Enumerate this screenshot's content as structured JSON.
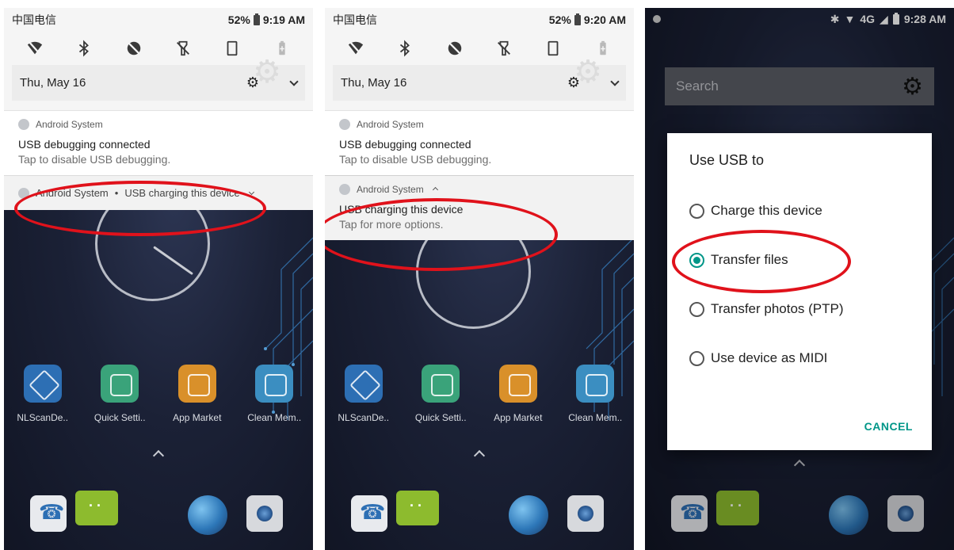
{
  "panel1": {
    "carrier": "中国电信",
    "battery": "52%",
    "time": "9:19 AM",
    "date": "Thu, May 16",
    "notif_debug": {
      "app": "Android System",
      "title": "USB debugging connected",
      "text": "Tap to disable USB debugging."
    },
    "notif_collapsed": {
      "app": "Android System",
      "summary": "USB charging this device"
    }
  },
  "panel2": {
    "carrier": "中国电信",
    "battery": "52%",
    "time": "9:20 AM",
    "date": "Thu, May 16",
    "notif_debug": {
      "app": "Android System",
      "title": "USB debugging connected",
      "text": "Tap to disable USB debugging."
    },
    "notif_expanded": {
      "app": "Android System",
      "title": "USB charging this device",
      "text": "Tap for more options."
    }
  },
  "panel3": {
    "time": "9:28 AM",
    "network": "4G",
    "search_placeholder": "Search",
    "dialog": {
      "title": "Use USB to",
      "options": [
        "Charge this device",
        "Transfer files",
        "Transfer photos (PTP)",
        "Use device as MIDI"
      ],
      "selected_index": 1,
      "cancel": "CANCEL"
    }
  },
  "apps": [
    "NLScanDe..",
    "Quick Setti..",
    "App Market",
    "Clean Mem.."
  ],
  "icons": {
    "qs": [
      "wifi-off-icon",
      "bluetooth-icon",
      "dnd-icon",
      "flashlight-off-icon",
      "portrait-icon",
      "battery-saver-icon"
    ]
  },
  "colors": {
    "annotation": "#e0121b",
    "accent": "#009688"
  }
}
